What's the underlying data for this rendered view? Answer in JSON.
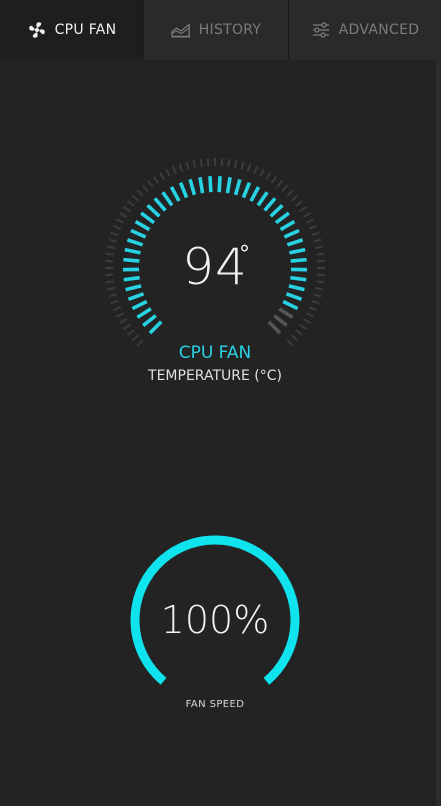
{
  "tabs": [
    {
      "label": "CPU FAN",
      "icon": "fan-icon",
      "active": true
    },
    {
      "label": "HISTORY",
      "icon": "area-chart-icon",
      "active": false
    },
    {
      "label": "ADVANCED",
      "icon": "sliders-icon",
      "active": false
    }
  ],
  "temperature": {
    "value": "94",
    "degree_symbol": "°",
    "title": "CPU FAN",
    "unit_label": "TEMPERATURE (°C)",
    "level_fraction": 0.94
  },
  "fan": {
    "value": "100%",
    "label": "FAN SPEED",
    "level_fraction": 1.0
  },
  "colors": {
    "accent": "#27d3e3",
    "ring": "#0fe3ee",
    "background": "#232323",
    "tick_inactive": "#555555",
    "tick_outer": "#3c3c3c"
  }
}
